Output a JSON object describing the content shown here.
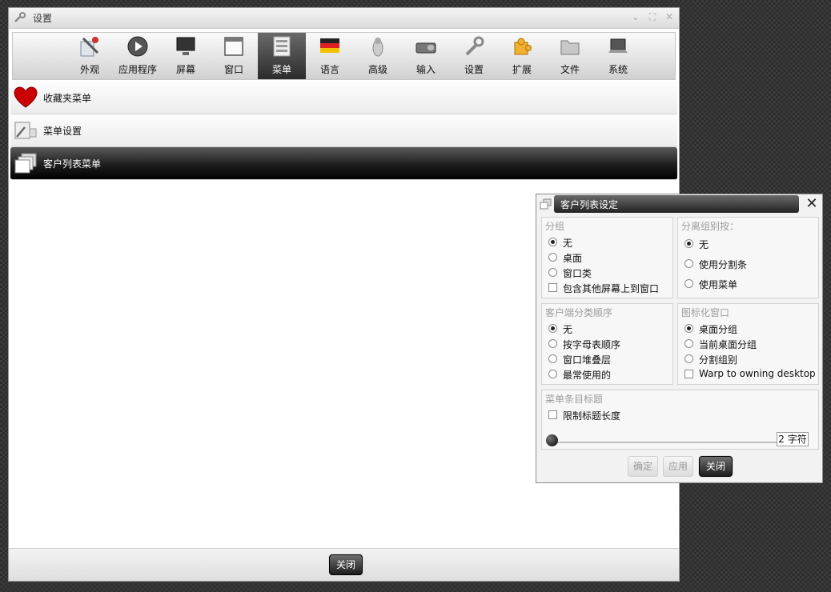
{
  "window": {
    "title": "设置"
  },
  "toolbar": {
    "items": [
      {
        "label": "外观",
        "icon": "paint-tools-icon"
      },
      {
        "label": "应用程序",
        "icon": "play-icon"
      },
      {
        "label": "屏幕",
        "icon": "monitor-icon"
      },
      {
        "label": "窗口",
        "icon": "window-icon"
      },
      {
        "label": "菜单",
        "icon": "menu-icon"
      },
      {
        "label": "语言",
        "icon": "flag-icon"
      },
      {
        "label": "高级",
        "icon": "penguin-icon"
      },
      {
        "label": "输入",
        "icon": "keyboard-mouse-icon"
      },
      {
        "label": "设置",
        "icon": "wrench-icon"
      },
      {
        "label": "扩展",
        "icon": "puzzle-icon"
      },
      {
        "label": "文件",
        "icon": "folder-icon"
      },
      {
        "label": "系统",
        "icon": "laptop-icon"
      }
    ],
    "active_index": 4
  },
  "list": {
    "items": [
      {
        "label": "收藏夹菜单",
        "icon": "heart-icon"
      },
      {
        "label": "菜单设置",
        "icon": "menu-settings-icon"
      },
      {
        "label": "客户列表菜单",
        "icon": "window-list-icon"
      }
    ],
    "selected_index": 2
  },
  "main_close_label": "关闭",
  "dialog": {
    "title": "客户列表设定",
    "close_glyph": "✕",
    "group_by": {
      "title": "分组",
      "options": [
        "无",
        "桌面",
        "窗口类"
      ],
      "selected": 0,
      "checkbox": "包含其他屏幕上到窗口",
      "checkbox_checked": false
    },
    "separate_by": {
      "title": "分离组别按：",
      "options": [
        "无",
        "使用分割条",
        "使用菜单"
      ],
      "selected": 0
    },
    "sort_order": {
      "title": "客户端分类顺序",
      "options": [
        "无",
        "按字母表顺序",
        "窗口堆叠层",
        "最常使用的"
      ],
      "selected": 0
    },
    "iconified": {
      "title": "图标化窗口",
      "options": [
        "桌面分组",
        "当前桌面分组",
        "分割组别"
      ],
      "selected": 0,
      "checkbox": "Warp to owning desktop",
      "checkbox_checked": false
    },
    "menu_title": {
      "title": "菜单条目标题",
      "checkbox": "限制标题长度",
      "checkbox_checked": false,
      "spin_value": "2 字符",
      "slider_level": 0
    },
    "buttons": {
      "ok": "确定",
      "apply": "应用",
      "close": "关闭"
    }
  }
}
